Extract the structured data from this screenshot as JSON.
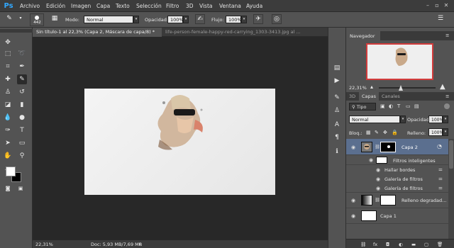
{
  "app": {
    "logo": "Ps"
  },
  "menu": [
    "Archivo",
    "Edición",
    "Imagen",
    "Capa",
    "Texto",
    "Selección",
    "Filtro",
    "3D",
    "Vista",
    "Ventana",
    "Ayuda"
  ],
  "options": {
    "brush_size": "442",
    "mode_label": "Modo:",
    "mode_value": "Normal",
    "opacity_label": "Opacidad:",
    "opacity_value": "100%",
    "flow_label": "Flujo:",
    "flow_value": "100%"
  },
  "tabs": [
    {
      "label": "Sin título-1 al 22,3% (Capa 2, Máscara de capa/8) *"
    },
    {
      "label": "life-person-female-happy-red-carrying_1303-3413.jpg al ..."
    }
  ],
  "status": {
    "zoom": "22,31%",
    "doc": "Doc: 5,93 MB/7,69 MB"
  },
  "navigator": {
    "title": "Navegador",
    "zoom": "22,31%"
  },
  "layers_panel": {
    "tabs": [
      "3D",
      "Capas",
      "Canales"
    ],
    "filter_kind": "Tipo",
    "blend_mode": "Normal",
    "opacity_label": "Opacidad:",
    "opacity_value": "100%",
    "lock_label": "Bloq.:",
    "fill_label": "Relleno:",
    "fill_value": "100%",
    "layers": [
      {
        "name": "Capa 2"
      },
      {
        "name": "Filtros inteligentes"
      },
      {
        "name": "Hallar bordes"
      },
      {
        "name": "Galería de filtros"
      },
      {
        "name": "Galería de filtros"
      },
      {
        "name": "Relleno degradad..."
      },
      {
        "name": "Capa 1"
      }
    ]
  },
  "colors": {
    "accent_logo": "#31a8ff",
    "selected_layer": "#5b6f8f",
    "nav_frame": "#d23c3c"
  }
}
